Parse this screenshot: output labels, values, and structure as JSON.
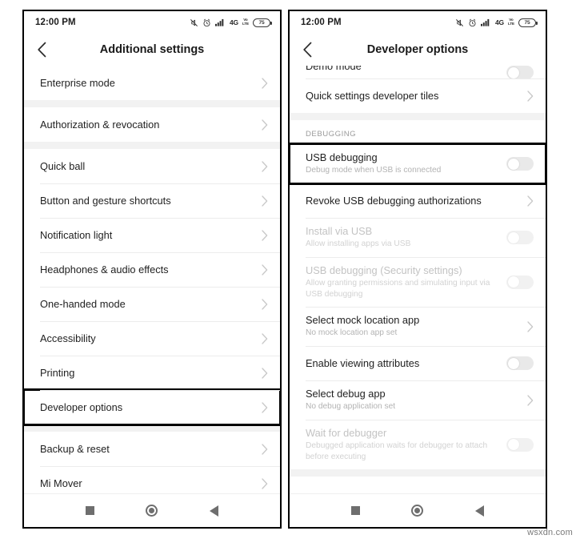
{
  "watermark": "wsxdn.com",
  "status_bar": {
    "time": "12:00 PM",
    "icons": [
      "mute-icon",
      "alarm-icon",
      "signal-bars-icon",
      "network-4g-label",
      "volte-icon",
      "battery-icon"
    ],
    "network_label": "4G",
    "volte_top": "Vo",
    "volte_bottom": "LTE",
    "battery_level": "75"
  },
  "nav_bar": {
    "recents_label": "recents",
    "home_label": "home",
    "back_label": "back"
  },
  "left_phone": {
    "appbar": {
      "back_icon": "chevron-left-icon",
      "title": "Additional settings"
    },
    "items": [
      {
        "id": "enterprise-mode",
        "title": "Enterprise mode",
        "control": "chevron",
        "gap_before": false,
        "highlight": false
      },
      {
        "id": "authorization-revocation",
        "title": "Authorization & revocation",
        "control": "chevron",
        "gap_before": true,
        "highlight": false
      },
      {
        "id": "quick-ball",
        "title": "Quick ball",
        "control": "chevron",
        "gap_before": true,
        "highlight": false
      },
      {
        "id": "button-gesture-shortcuts",
        "title": "Button and gesture shortcuts",
        "control": "chevron",
        "gap_before": false,
        "highlight": false
      },
      {
        "id": "notification-light",
        "title": "Notification light",
        "control": "chevron",
        "gap_before": false,
        "highlight": false
      },
      {
        "id": "headphones-audio-effects",
        "title": "Headphones & audio effects",
        "control": "chevron",
        "gap_before": false,
        "highlight": false
      },
      {
        "id": "one-handed-mode",
        "title": "One-handed mode",
        "control": "chevron",
        "gap_before": false,
        "highlight": false
      },
      {
        "id": "accessibility",
        "title": "Accessibility",
        "control": "chevron",
        "gap_before": false,
        "highlight": false
      },
      {
        "id": "printing",
        "title": "Printing",
        "control": "chevron",
        "gap_before": false,
        "highlight": false
      },
      {
        "id": "developer-options",
        "title": "Developer options",
        "control": "chevron",
        "gap_before": false,
        "highlight": true
      },
      {
        "id": "backup-reset",
        "title": "Backup & reset",
        "control": "chevron",
        "gap_before": true,
        "highlight": false
      },
      {
        "id": "mi-mover",
        "title": "Mi Mover",
        "control": "chevron",
        "gap_before": false,
        "highlight": false
      }
    ]
  },
  "right_phone": {
    "appbar": {
      "back_icon": "chevron-left-icon",
      "title": "Developer options"
    },
    "items": [
      {
        "id": "demo-mode",
        "title": "Demo mode",
        "subtitle": "",
        "control": "toggle",
        "toggle_on": false,
        "disabled": false,
        "clipped": true,
        "gap_before": false,
        "highlight": false
      },
      {
        "id": "quick-settings-developer-tiles",
        "title": "Quick settings developer tiles",
        "subtitle": "",
        "control": "chevron",
        "disabled": false,
        "clipped": false,
        "gap_before": false,
        "highlight": false
      },
      {
        "id": "debugging-header",
        "title": "DEBUGGING",
        "control": "section",
        "gap_before": true
      },
      {
        "id": "usb-debugging",
        "title": "USB debugging",
        "subtitle": "Debug mode when USB is connected",
        "control": "toggle",
        "toggle_on": false,
        "disabled": false,
        "clipped": false,
        "gap_before": false,
        "highlight": true
      },
      {
        "id": "revoke-usb-debugging-authorizations",
        "title": "Revoke USB debugging authorizations",
        "subtitle": "",
        "control": "chevron",
        "disabled": false,
        "clipped": false,
        "gap_before": false,
        "highlight": false
      },
      {
        "id": "install-via-usb",
        "title": "Install via USB",
        "subtitle": "Allow installing apps via USB",
        "control": "toggle",
        "toggle_on": false,
        "disabled": true,
        "clipped": false,
        "gap_before": false,
        "highlight": false
      },
      {
        "id": "usb-debugging-security-settings",
        "title": "USB debugging (Security settings)",
        "subtitle": "Allow granting permissions and simulating input via USB debugging",
        "control": "toggle",
        "toggle_on": false,
        "disabled": true,
        "clipped": false,
        "gap_before": false,
        "highlight": false
      },
      {
        "id": "select-mock-location-app",
        "title": "Select mock location app",
        "subtitle": "No mock location app set",
        "control": "chevron",
        "disabled": false,
        "clipped": false,
        "gap_before": false,
        "highlight": false
      },
      {
        "id": "enable-viewing-attributes",
        "title": "Enable viewing attributes",
        "subtitle": "",
        "control": "toggle",
        "toggle_on": false,
        "disabled": false,
        "clipped": false,
        "gap_before": false,
        "highlight": false
      },
      {
        "id": "select-debug-app",
        "title": "Select debug app",
        "subtitle": "No debug application set",
        "control": "chevron",
        "disabled": false,
        "clipped": false,
        "gap_before": false,
        "highlight": false
      },
      {
        "id": "wait-for-debugger",
        "title": "Wait for debugger",
        "subtitle": "Debugged application waits for debugger to attach before executing",
        "control": "toggle",
        "toggle_on": false,
        "disabled": true,
        "clipped": false,
        "gap_before": false,
        "highlight": false
      }
    ]
  }
}
